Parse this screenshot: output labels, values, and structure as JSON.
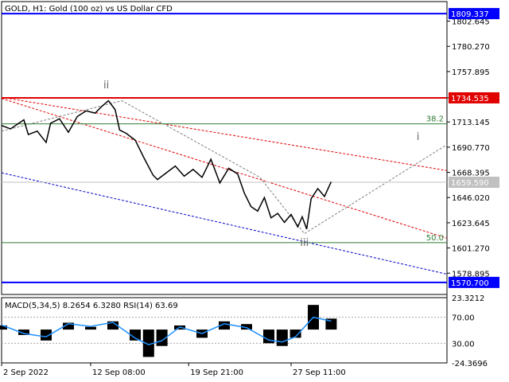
{
  "header": {
    "symbol_title": "GOLD, H1:  Gold (100 oz) vs US Dollar CFD",
    "indicator_title": "MACD(5,34,5) 8.2654 6.3280 RSI(14) 63.69"
  },
  "colors": {
    "price": "#000000",
    "channel_top": "#e00000",
    "channel_bottom": "#0000cc",
    "resistance": "#e00000",
    "levels_blue": "#0000ff",
    "fibo": "#2e7d32",
    "projection": "#808080",
    "rsi": "#1e90ff",
    "label_bg": "#0000ff",
    "label_red": "#e00000"
  },
  "chart_data": [
    {
      "type": "line",
      "title": "GOLD, H1:  Gold (100 oz) vs US Dollar CFD",
      "ylim": [
        1560,
        1820
      ],
      "x_ticks": [
        "2 Sep 2022",
        "12 Sep 08:00",
        "19 Sep 21:00",
        "27 Sep 11:00"
      ],
      "y_ticks": [
        1802.645,
        1780.27,
        1757.895,
        1734.535,
        1713.145,
        1690.77,
        1668.395,
        1646.02,
        1623.645,
        1601.27,
        1578.895
      ],
      "horizontal_levels": [
        {
          "label": "1809.337",
          "value": 1809.337,
          "style": "blue"
        },
        {
          "label": "1734.535",
          "value": 1734.535,
          "style": "red"
        },
        {
          "label": "1659.590",
          "value": 1659.59,
          "style": "current"
        },
        {
          "label": "1570.700",
          "value": 1570.7,
          "style": "blue"
        }
      ],
      "fibo_levels": [
        {
          "label": "38.2",
          "value": 1711.5
        },
        {
          "label": "50.0",
          "value": 1606.0
        }
      ],
      "wave_labels": [
        {
          "label": "ii",
          "x": 0.235,
          "value": 1743.0
        },
        {
          "label": "iii",
          "x": 0.68,
          "value": 1603.0
        },
        {
          "label": "i",
          "x": 0.935,
          "value": 1697.0
        }
      ],
      "series": [
        {
          "name": "",
          "x": [
            0.0,
            0.02,
            0.035,
            0.05,
            0.06,
            0.08,
            0.1,
            0.11,
            0.13,
            0.15,
            0.17,
            0.19,
            0.21,
            0.225,
            0.24,
            0.255,
            0.265,
            0.28,
            0.3,
            0.32,
            0.34,
            0.35,
            0.37,
            0.39,
            0.41,
            0.43,
            0.45,
            0.47,
            0.49,
            0.51,
            0.53,
            0.545,
            0.56,
            0.575,
            0.59,
            0.605,
            0.62,
            0.635,
            0.65,
            0.665,
            0.675,
            0.685,
            0.695,
            0.71,
            0.725,
            0.74
          ],
          "values": [
            1710,
            1707,
            1711,
            1715,
            1702,
            1705,
            1695,
            1712,
            1716,
            1704,
            1718,
            1723,
            1721,
            1727,
            1732,
            1724,
            1706,
            1703,
            1697,
            1681,
            1666,
            1662,
            1668,
            1674,
            1665,
            1671,
            1664,
            1680,
            1659,
            1672,
            1667,
            1650,
            1638,
            1634,
            1646,
            1628,
            1632,
            1624,
            1631,
            1620,
            1629,
            1618,
            1645,
            1654,
            1647,
            1660
          ]
        }
      ],
      "trendlines": [
        {
          "name": "channel-top-red",
          "x": [
            0.0,
            1.0
          ],
          "values": [
            1735,
            1670
          ]
        },
        {
          "name": "channel-mid-red",
          "x": [
            0.0,
            1.0
          ],
          "values": [
            1734,
            1610
          ]
        },
        {
          "name": "channel-bottom-blue",
          "x": [
            0.0,
            1.0
          ],
          "values": [
            1668,
            1578
          ]
        },
        {
          "name": "projection-gray",
          "x": [
            0.0,
            0.27,
            0.58,
            0.68,
            1.0
          ],
          "values": [
            1705,
            1732,
            1664,
            1614,
            1693
          ]
        }
      ]
    },
    {
      "type": "bar",
      "title": "MACD(5,34,5) 8.2654 6.3280 RSI(14) 63.69",
      "ylim": [
        -24.3696,
        23.3212
      ],
      "y_ticks": [
        "23.3212",
        "70.00",
        "30.00",
        "-24.3696"
      ],
      "series": [
        {
          "name": "MACD",
          "x": [
            0.0,
            0.05,
            0.1,
            0.15,
            0.2,
            0.25,
            0.3,
            0.33,
            0.36,
            0.4,
            0.45,
            0.5,
            0.55,
            0.6,
            0.63,
            0.66,
            0.7,
            0.74
          ],
          "values": [
            3,
            -4,
            -8,
            5,
            2,
            6,
            -8,
            -20,
            -12,
            3,
            -6,
            6,
            4,
            -10,
            -12,
            -6,
            18,
            8
          ]
        },
        {
          "name": "RSI",
          "x": [
            0.0,
            0.05,
            0.1,
            0.15,
            0.2,
            0.25,
            0.3,
            0.33,
            0.36,
            0.4,
            0.45,
            0.5,
            0.55,
            0.6,
            0.63,
            0.66,
            0.7,
            0.74
          ],
          "values": [
            58,
            45,
            40,
            60,
            56,
            62,
            38,
            28,
            34,
            55,
            45,
            60,
            54,
            35,
            32,
            40,
            70,
            64
          ]
        }
      ]
    }
  ]
}
